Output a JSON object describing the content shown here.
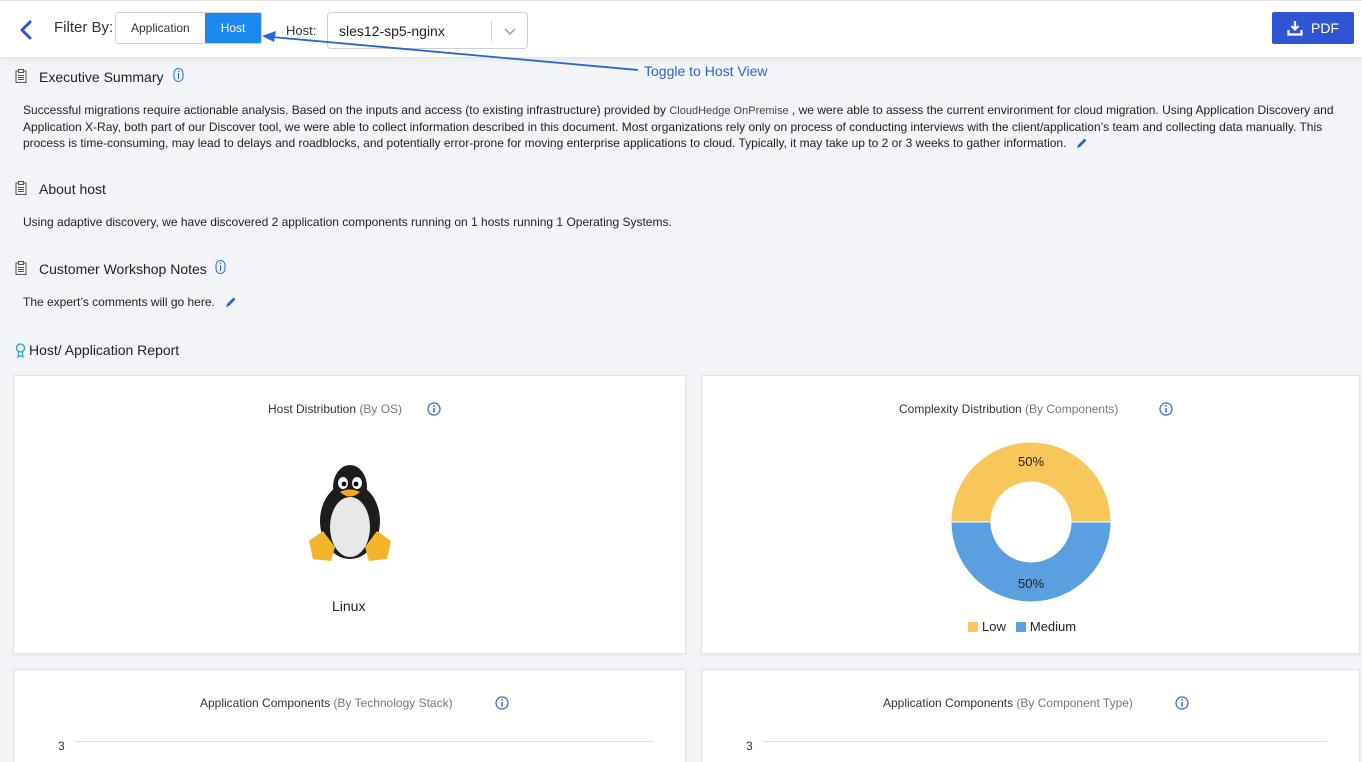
{
  "topbar": {
    "filter_label": "Filter By:",
    "filter_options": [
      "Application",
      "Host"
    ],
    "active_filter": "Host",
    "host_label": "Host:",
    "host_value": "sles12-sp5-nginx",
    "pdf_label": "PDF",
    "colors": {
      "primary": "#1a88ee",
      "pdf": "#2f55d4"
    }
  },
  "annotation": {
    "text": "Toggle to Host View",
    "color": "#2a62d7"
  },
  "executive_summary": {
    "title": "Executive Summary",
    "text_before": "Successful migrations require actionable analysis. Based on the inputs and access (to existing infrastructure) provided by ",
    "brand": "CloudHedge OnPremise",
    "text_after": " , we were able to assess the current environment for cloud migration. Using Application Discovery and Application X-Ray, both part of our Discover tool, we were able to collect information described in this document. Most organizations rely only on process of conducting interviews with the client/application’s team and collecting data manually. This process is time-consuming, may lead to delays and roadblocks, and potentially error-prone for moving enterprise applications to cloud. Typically, it may take up to 2 or 3 weeks to gather information."
  },
  "about_host": {
    "title": "About host",
    "text": "Using adaptive discovery, we have discovered 2 application components running on 1 hosts running 1 Operating Systems."
  },
  "workshop_notes": {
    "title": "Customer Workshop Notes",
    "text": "The expert’s comments will go here."
  },
  "report": {
    "title": "Host/ Application Report"
  },
  "cards": {
    "host_dist": {
      "title": "Host Distribution",
      "subtitle": " (By OS)",
      "os_label": "Linux"
    },
    "complexity": {
      "title": "Complexity Distribution",
      "subtitle": " (By Components)"
    },
    "tech_stack": {
      "title": "Application Components",
      "subtitle": " (By Technology Stack)",
      "y_top": "3"
    },
    "comp_type": {
      "title": "Application Components",
      "subtitle": " (By Component Type)",
      "y_top": "3"
    }
  },
  "chart_data": {
    "type": "pie",
    "donut": true,
    "categories": [
      "Low",
      "Medium"
    ],
    "values": [
      50,
      50
    ],
    "labels": [
      "50%",
      "50%"
    ],
    "colors": [
      "#f8c75b",
      "#5a9fdf"
    ],
    "legend": "bottom"
  }
}
